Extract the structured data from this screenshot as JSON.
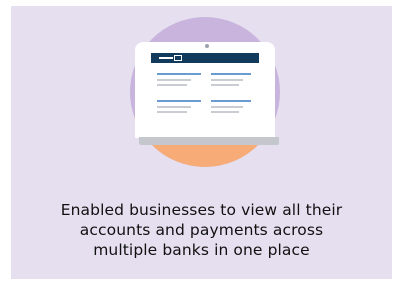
{
  "caption": {
    "lines": [
      "Enabled businesses to view all their",
      "accounts and payments across",
      "multiple banks in one place"
    ]
  },
  "illustration": {
    "icon": "laptop-dashboard-icon",
    "colors": {
      "card_background": "#e6dff0",
      "circle_top": "#c8b4dc",
      "circle_bottom": "#f7ac78",
      "screen_header": "#123a5c",
      "accent_line": "#6a9bd1",
      "muted_line": "#c9cdd2"
    }
  }
}
